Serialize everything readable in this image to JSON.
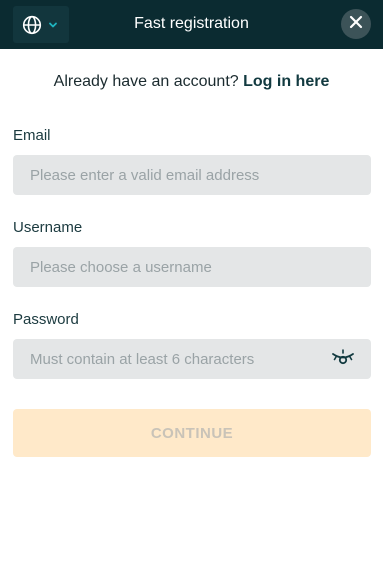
{
  "header": {
    "title": "Fast registration",
    "language_icon": "globe-icon",
    "dropdown_icon": "chevron-down-icon",
    "close_icon": "close-icon"
  },
  "login_prompt": {
    "text": "Already have an account?",
    "link": "Log in here"
  },
  "form": {
    "email": {
      "label": "Email",
      "placeholder": "Please enter a valid email address",
      "value": ""
    },
    "username": {
      "label": "Username",
      "placeholder": "Please choose a username",
      "value": ""
    },
    "password": {
      "label": "Password",
      "placeholder": "Must contain at least 6 characters",
      "value": "",
      "toggle_icon": "eye-closed-icon"
    }
  },
  "continue_button": {
    "label": "CONTINUE"
  },
  "colors": {
    "header_bg": "#0b2b31",
    "accent": "#1fb5c0",
    "input_bg": "#e4e6e7",
    "button_disabled_bg": "#ffe9c9"
  }
}
